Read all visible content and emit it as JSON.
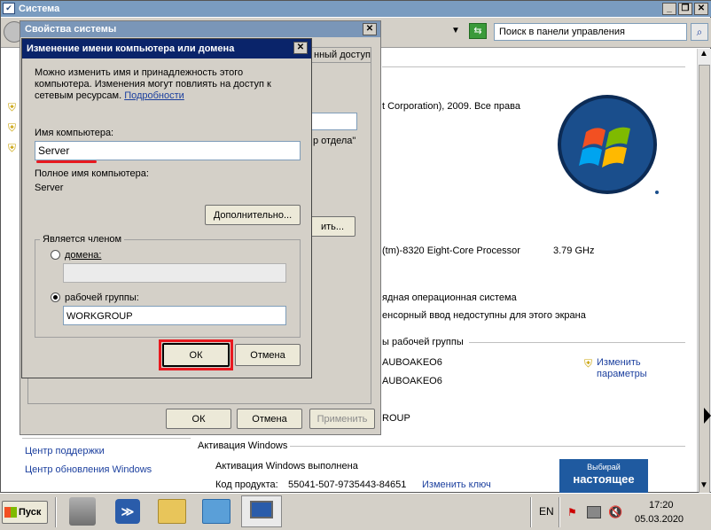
{
  "main_window": {
    "title": "Система",
    "search_placeholder": "Поиск в панели управления"
  },
  "control_panel": {
    "copyright": "t Corporation), 2009. Все права",
    "processor_name": "(tm)-8320 Eight-Core Processor",
    "processor_speed": "3.79 GHz",
    "os_type": "ядная операционная система",
    "touch": "енсорный ввод недоступны для этого экрана",
    "group_header": "ы рабочей группы",
    "computer_name": "AUBOAKEO6",
    "full_name": "AUBOAKEO6",
    "workgroup": "ROUP",
    "change_settings": "Изменить параметры",
    "see_also": {
      "support_center": "Центр поддержки",
      "windows_update": "Центр обновления Windows"
    },
    "activation_header": "Активация Windows",
    "activation_status": "Активация Windows выполнена",
    "product_key_label": "Код продукта:",
    "product_key": "55041-507-9735443-84651",
    "change_key": "Изменить ключ",
    "genuine_badge_line1": "Выбирай",
    "genuine_badge_line2": "настоящее"
  },
  "sys_props": {
    "title": "Свойства системы",
    "tab_remote": "нный доступ",
    "field_value": "",
    "description_hint": "р отдела\"",
    "change_button": "ить...",
    "ok": "ОК",
    "cancel": "Отмена",
    "apply": "Применить"
  },
  "rename_dialog": {
    "title": "Изменение имени компьютера или домена",
    "description": "Можно изменить имя и принадлежность этого компьютера. Изменения могут повлиять на доступ к сетевым ресурсам.",
    "details_link": "Подробности",
    "computer_name_label": "Имя компьютера:",
    "computer_name_value": "Server",
    "full_name_label": "Полное имя компьютера:",
    "full_name_value": "Server",
    "more_button": "Дополнительно...",
    "member_of_label": "Является членом",
    "domain_label": "домена:",
    "domain_value": "",
    "workgroup_label": "рабочей группы:",
    "workgroup_value": "WORKGROUP",
    "ok": "ОК",
    "cancel": "Отмена"
  },
  "taskbar": {
    "start": "Пуск",
    "lang": "EN",
    "time": "17:20",
    "date": "05.03.2020"
  },
  "colors": {
    "highlight": "#e8191f",
    "dialog_title": "#0a246a",
    "taskbar": "#d4d0c8"
  }
}
